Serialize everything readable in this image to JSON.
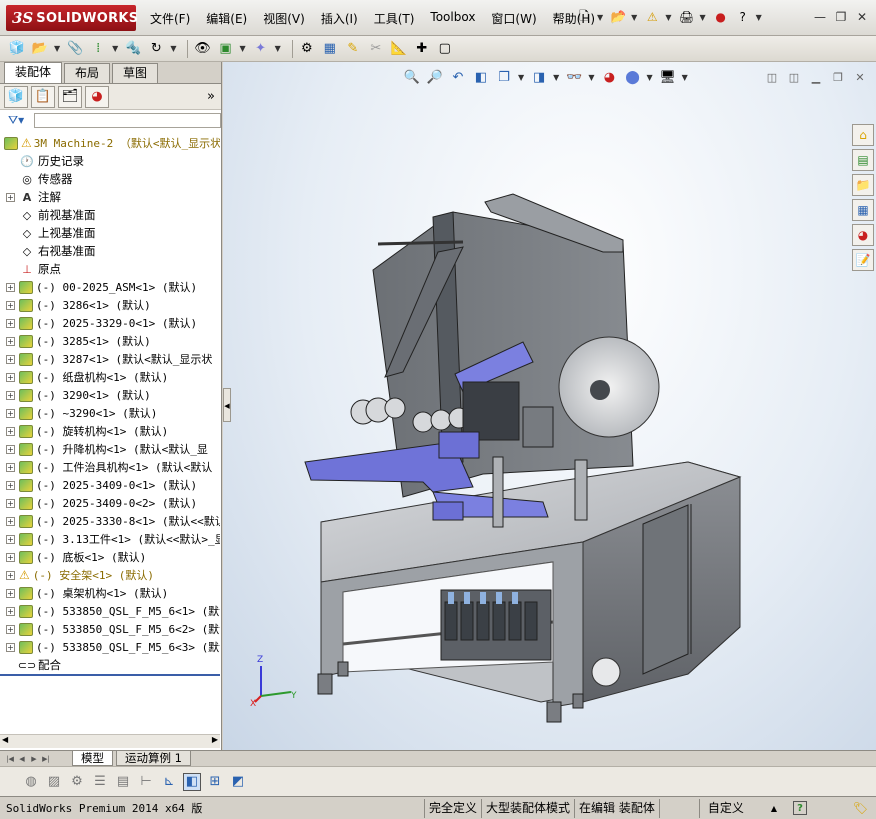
{
  "app": {
    "logo_ds": "3S",
    "logo_text": "SOLIDWORKS"
  },
  "menu": [
    "文件(F)",
    "编辑(E)",
    "视图(V)",
    "插入(I)",
    "工具(T)",
    "Toolbox",
    "窗口(W)",
    "帮助(H)"
  ],
  "title_tools": {
    "help_icon_text": "?"
  },
  "cm_tabs": [
    "装配体",
    "布局",
    "草图"
  ],
  "tree": {
    "root": "3M Machine-2 （默认<默认_显示状",
    "fixed_items": [
      "历史记录",
      "传感器",
      "注解",
      "前视基准面",
      "上视基准面",
      "右视基准面",
      "原点"
    ],
    "components": [
      "(-) 00-2025_ASM<1> (默认)",
      "(-) 3286<1> (默认)",
      "(-) 2025-3329-0<1> (默认)",
      "(-) 3285<1> (默认)",
      "(-) 3287<1> (默认<默认_显示状",
      "(-) 纸盘机构<1> (默认)",
      "(-) 3290<1> (默认)",
      "(-) ~3290<1> (默认)",
      "(-) 旋转机构<1> (默认)",
      "(-) 升降机构<1> (默认<默认_显",
      "(-) 工件治具机构<1> (默认<默认",
      "(-) 2025-3409-0<1> (默认)",
      "(-) 2025-3409-0<2> (默认)",
      "(-) 2025-3330-8<1> (默认<<默认",
      "(-) 3.13工件<1> (默认<<默认>_显",
      "(-) 底板<1> (默认)",
      "(-) 安全架<1> (默认)",
      "(-) 桌架机构<1> (默认)",
      "(-) 533850_QSL_F_M5_6<1> (默认",
      "(-) 533850_QSL_F_M5_6<2> (默认",
      "(-) 533850_QSL_F_M5_6<3> (默认"
    ],
    "mates": "配合"
  },
  "bottom_tabs": [
    "模型",
    "运动算例 1"
  ],
  "status": {
    "app": "SolidWorks Premium 2014 x64 版",
    "defined": "完全定义",
    "mode": "大型装配体模式",
    "editing": "在编辑 装配体",
    "units": "自定义"
  },
  "triad": {
    "x": "X",
    "y": "Y",
    "z": "Z"
  },
  "colors": {
    "accent": "#c8262b",
    "part_blue": "#6f73d8",
    "frame_gray": "#8a8d92"
  }
}
